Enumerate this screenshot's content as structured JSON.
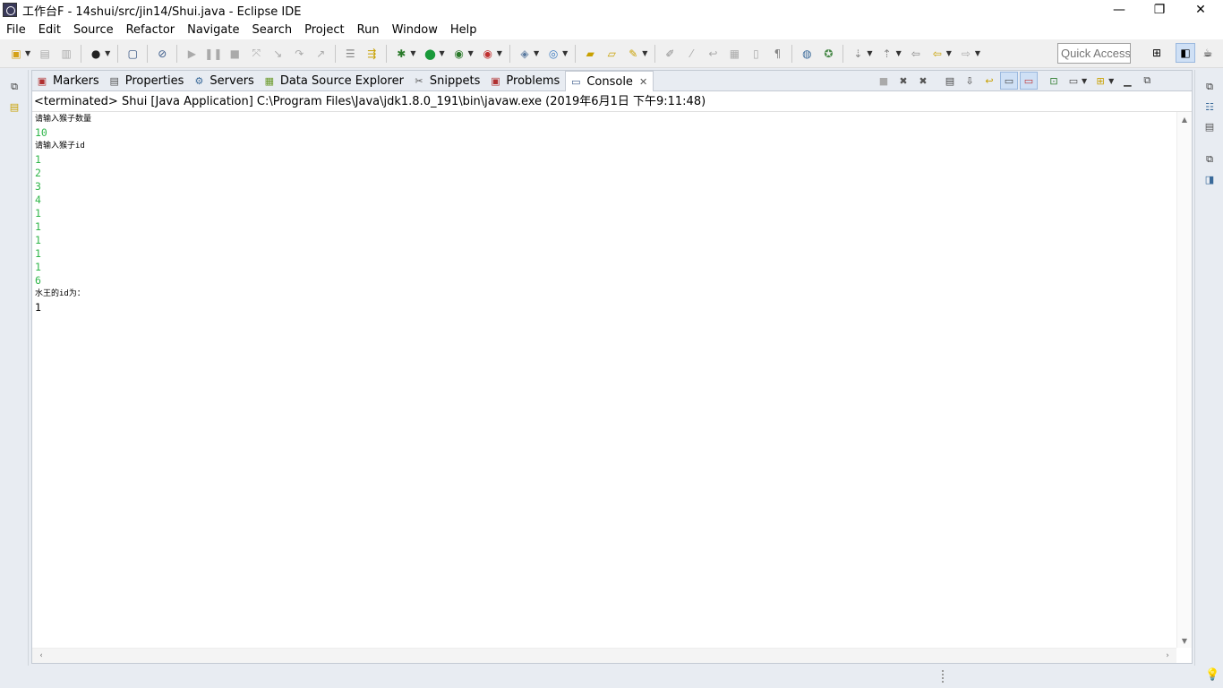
{
  "window": {
    "title": "工作台F - 14shui/src/jin14/Shui.java - Eclipse IDE",
    "minimize": "—",
    "restore": "❐",
    "close": "✕"
  },
  "menu": [
    "File",
    "Edit",
    "Source",
    "Refactor",
    "Navigate",
    "Search",
    "Project",
    "Run",
    "Window",
    "Help"
  ],
  "toolbar": {
    "quick_access_placeholder": "Quick Access"
  },
  "tabs": [
    {
      "label": "Markers",
      "icon": "markers-icon"
    },
    {
      "label": "Properties",
      "icon": "properties-icon"
    },
    {
      "label": "Servers",
      "icon": "servers-icon"
    },
    {
      "label": "Data Source Explorer",
      "icon": "data-source-icon"
    },
    {
      "label": "Snippets",
      "icon": "snippets-icon"
    },
    {
      "label": "Problems",
      "icon": "problems-icon"
    },
    {
      "label": "Console",
      "icon": "console-icon",
      "active": true
    }
  ],
  "console": {
    "header": "<terminated> Shui [Java Application] C:\\Program Files\\Java\\jdk1.8.0_191\\bin\\javaw.exe (2019年6月1日 下午9:11:48)",
    "lines": [
      {
        "text": "请输入猴子数量",
        "kind": "out"
      },
      {
        "text": "10",
        "kind": "in"
      },
      {
        "text": "请输入猴子id",
        "kind": "out"
      },
      {
        "text": "1",
        "kind": "in"
      },
      {
        "text": "2",
        "kind": "in"
      },
      {
        "text": "3",
        "kind": "in"
      },
      {
        "text": "4",
        "kind": "in"
      },
      {
        "text": "1",
        "kind": "in"
      },
      {
        "text": "1",
        "kind": "in"
      },
      {
        "text": "1",
        "kind": "in"
      },
      {
        "text": "1",
        "kind": "in"
      },
      {
        "text": "1",
        "kind": "in"
      },
      {
        "text": "6",
        "kind": "in"
      },
      {
        "text": "水王的id为：",
        "kind": "out"
      },
      {
        "text": "1",
        "kind": "out"
      }
    ]
  },
  "colors": {
    "input_text": "#2fb64a",
    "output_text": "#000000",
    "tab_bar": "#e8ecf2"
  }
}
